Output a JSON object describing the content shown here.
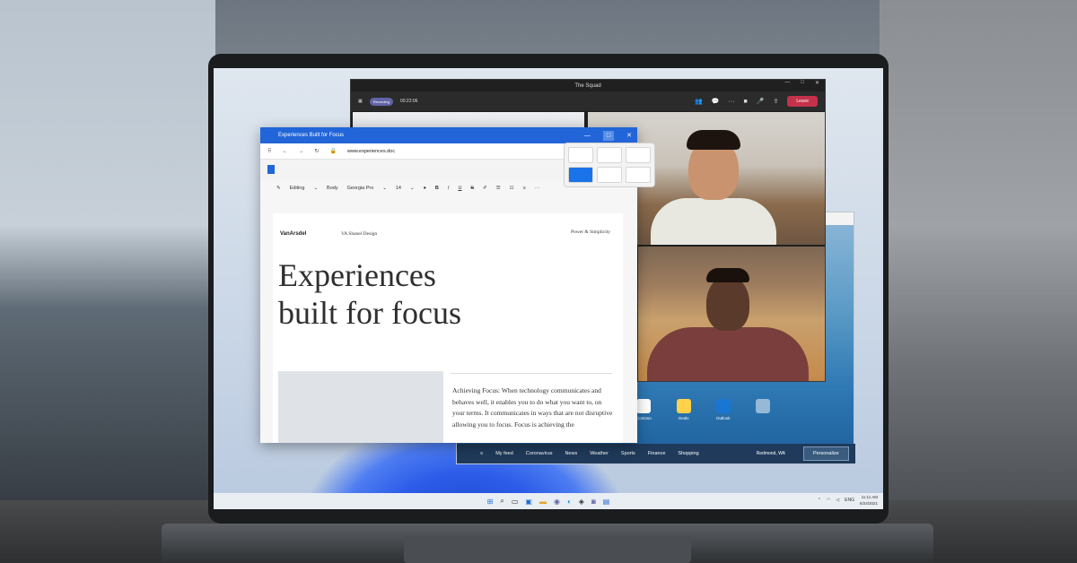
{
  "teams": {
    "title": "The Squad",
    "recording_badge": "Recording",
    "timer": "00:22:06",
    "leave_label": "Leave"
  },
  "word": {
    "window_title": "Experiences Built for Focus",
    "url": "www.experiences.doc",
    "ribbon": {
      "editing": "Editing",
      "style": "Body",
      "font": "Georgia Pro",
      "size": "14"
    },
    "doc": {
      "brand": "VanArsdel",
      "header_center": "VA Shanel Design",
      "header_right": "Power & Simplicity",
      "headline": "Experiences\nbuilt for focus",
      "paragraph": "Achieving Focus: When technology communicates and behaves well, it enables you to do what you want to, on your terms. It communicates in ways that are not disruptive allowing you to focus. Focus is achieving the"
    }
  },
  "news": {
    "apps": [
      "Contoso",
      "Deals",
      "Outlook"
    ],
    "nav": [
      "My feed",
      "Coronavirus",
      "News",
      "Weather",
      "Sports",
      "Finance",
      "Shopping"
    ],
    "location": "Redmond, WA",
    "personalize_label": "Personalize"
  },
  "taskbar": {
    "time": "11:11 AM",
    "date": "6/24/2021",
    "lang": "ENG"
  },
  "colors": {
    "word_accent": "#2165d8",
    "teams_leave": "#c4314b",
    "teams_badge": "#6264a7"
  }
}
